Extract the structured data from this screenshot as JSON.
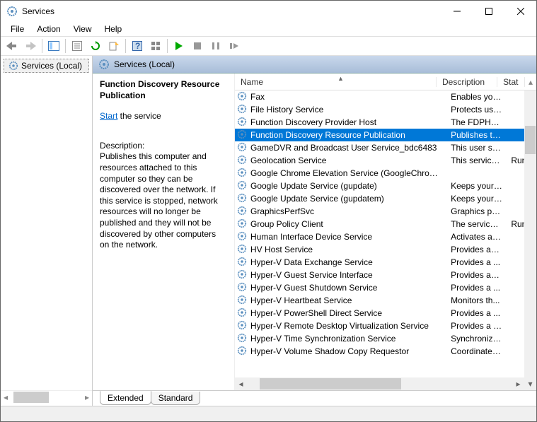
{
  "window": {
    "title": "Services"
  },
  "menus": [
    "File",
    "Action",
    "View",
    "Help"
  ],
  "tree": {
    "root": "Services (Local)"
  },
  "header": {
    "title": "Services (Local)"
  },
  "detail": {
    "service_name": "Function Discovery Resource Publication",
    "start_link": "Start",
    "start_suffix": " the service",
    "desc_label": "Description:",
    "description": "Publishes this computer and resources attached to this computer so they can be discovered over the network.  If this service is stopped, network resources will no longer be published and they will not be discovered by other computers on the network."
  },
  "columns": {
    "name": "Name",
    "description": "Description",
    "status": "Stat"
  },
  "rows": [
    {
      "name": "Fax",
      "desc": "Enables you...",
      "status": ""
    },
    {
      "name": "File History Service",
      "desc": "Protects use...",
      "status": ""
    },
    {
      "name": "Function Discovery Provider Host",
      "desc": "The FDPHO...",
      "status": ""
    },
    {
      "name": "Function Discovery Resource Publication",
      "desc": "Publishes th...",
      "status": "",
      "selected": true
    },
    {
      "name": "GameDVR and Broadcast User Service_bdc6483",
      "desc": "This user ser...",
      "status": ""
    },
    {
      "name": "Geolocation Service",
      "desc": "This service ...",
      "status": "Runn"
    },
    {
      "name": "Google Chrome Elevation Service (GoogleChrome...",
      "desc": "",
      "status": ""
    },
    {
      "name": "Google Update Service (gupdate)",
      "desc": "Keeps your ...",
      "status": ""
    },
    {
      "name": "Google Update Service (gupdatem)",
      "desc": "Keeps your ...",
      "status": ""
    },
    {
      "name": "GraphicsPerfSvc",
      "desc": "Graphics pe...",
      "status": ""
    },
    {
      "name": "Group Policy Client",
      "desc": "The service i...",
      "status": "Runn"
    },
    {
      "name": "Human Interface Device Service",
      "desc": "Activates an...",
      "status": ""
    },
    {
      "name": "HV Host Service",
      "desc": "Provides an ...",
      "status": ""
    },
    {
      "name": "Hyper-V Data Exchange Service",
      "desc": "Provides a ...",
      "status": ""
    },
    {
      "name": "Hyper-V Guest Service Interface",
      "desc": "Provides an ...",
      "status": ""
    },
    {
      "name": "Hyper-V Guest Shutdown Service",
      "desc": "Provides a ...",
      "status": ""
    },
    {
      "name": "Hyper-V Heartbeat Service",
      "desc": "Monitors th...",
      "status": ""
    },
    {
      "name": "Hyper-V PowerShell Direct Service",
      "desc": "Provides a ...",
      "status": ""
    },
    {
      "name": "Hyper-V Remote Desktop Virtualization Service",
      "desc": "Provides a p...",
      "status": ""
    },
    {
      "name": "Hyper-V Time Synchronization Service",
      "desc": "Synchronize...",
      "status": ""
    },
    {
      "name": "Hyper-V Volume Shadow Copy Requestor",
      "desc": "Coordinates...",
      "status": ""
    }
  ],
  "tabs": {
    "extended": "Extended",
    "standard": "Standard"
  }
}
